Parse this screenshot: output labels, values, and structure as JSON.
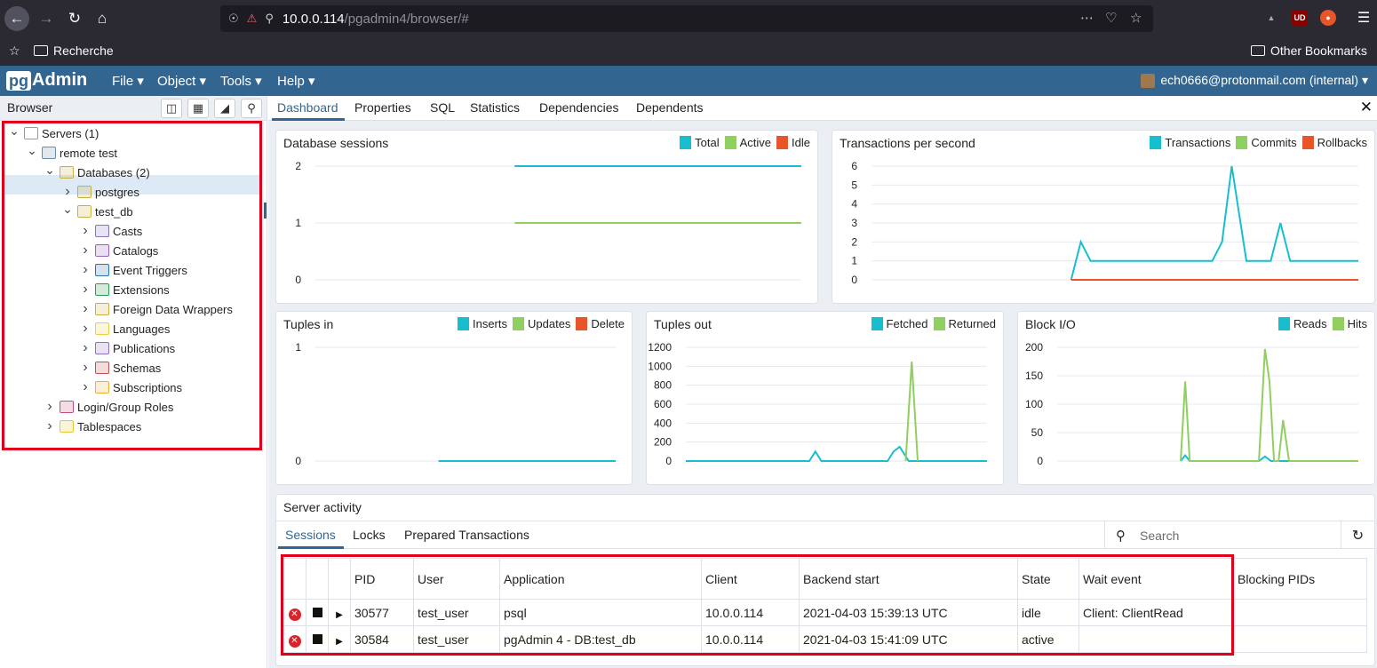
{
  "browser": {
    "url_host": "10.0.0.114",
    "url_path": "/pgadmin4/browser/#",
    "bookmark_left": "Recherche",
    "bookmark_right": "Other Bookmarks",
    "ext_ud": "UD"
  },
  "app": {
    "logo_pg": "pg",
    "logo_admin": "Admin",
    "menus": [
      "File ▾",
      "Object ▾",
      "Tools ▾",
      "Help ▾"
    ],
    "user": "ech0666@protonmail.com (internal) ▾"
  },
  "left_panel": {
    "title": "Browser",
    "tree": [
      {
        "label": "Servers (1)",
        "depth": 0,
        "expander": "v"
      },
      {
        "label": "remote test",
        "depth": 1,
        "expander": "v"
      },
      {
        "label": "Databases (2)",
        "depth": 2,
        "expander": "v"
      },
      {
        "label": "postgres",
        "depth": 3,
        "expander": ">"
      },
      {
        "label": "test_db",
        "depth": 3,
        "expander": "v",
        "selected": true
      },
      {
        "label": "Casts",
        "depth": 4,
        "expander": ">"
      },
      {
        "label": "Catalogs",
        "depth": 4,
        "expander": ">"
      },
      {
        "label": "Event Triggers",
        "depth": 4,
        "expander": ">"
      },
      {
        "label": "Extensions",
        "depth": 4,
        "expander": ">"
      },
      {
        "label": "Foreign Data Wrappers",
        "depth": 4,
        "expander": ">"
      },
      {
        "label": "Languages",
        "depth": 4,
        "expander": ">"
      },
      {
        "label": "Publications",
        "depth": 4,
        "expander": ">"
      },
      {
        "label": "Schemas",
        "depth": 4,
        "expander": ">"
      },
      {
        "label": "Subscriptions",
        "depth": 4,
        "expander": ">"
      },
      {
        "label": "Login/Group Roles",
        "depth": 2,
        "expander": ">"
      },
      {
        "label": "Tablespaces",
        "depth": 2,
        "expander": ">"
      }
    ]
  },
  "tabs": [
    "Dashboard",
    "Properties",
    "SQL",
    "Statistics",
    "Dependencies",
    "Dependents"
  ],
  "colors": {
    "cyan": "#17becf",
    "green": "#8fcf5f",
    "red": "#e8552a",
    "accent": "#326690"
  },
  "chart_data": [
    {
      "id": "db_sessions",
      "type": "line",
      "title": "Database sessions",
      "ylim": [
        0,
        2
      ],
      "yticks": [
        "2",
        "1",
        "0"
      ],
      "xrange": [
        0,
        100
      ],
      "series": [
        {
          "name": "Total",
          "color": "#17becf",
          "x": [
            41,
            100
          ],
          "values": [
            2,
            2
          ]
        },
        {
          "name": "Active",
          "color": "#8fcf5f",
          "x": [
            41,
            100
          ],
          "values": [
            1,
            1
          ]
        },
        {
          "name": "Idle",
          "color": "#e8552a",
          "x": [],
          "values": []
        }
      ]
    },
    {
      "id": "tps",
      "type": "line",
      "title": "Transactions per second",
      "ylim": [
        0,
        6
      ],
      "yticks": [
        "6",
        "5",
        "4",
        "3",
        "2",
        "1",
        "0"
      ],
      "xrange": [
        0,
        100
      ],
      "series": [
        {
          "name": "Transactions",
          "color": "#17becf",
          "x": [
            41,
            43,
            45,
            70,
            72,
            74,
            77,
            82,
            84,
            86,
            88,
            100
          ],
          "values": [
            0,
            2,
            1,
            1,
            2,
            6,
            1,
            1,
            3,
            1,
            1,
            1
          ]
        },
        {
          "name": "Commits",
          "color": "#8fcf5f",
          "x": [],
          "values": []
        },
        {
          "name": "Rollbacks",
          "color": "#e8552a",
          "x": [
            41,
            100
          ],
          "values": [
            0,
            0
          ]
        }
      ]
    },
    {
      "id": "tuples_in",
      "type": "line",
      "title": "Tuples in",
      "ylim": [
        0,
        1
      ],
      "yticks": [
        "1",
        "0"
      ],
      "xrange": [
        0,
        100
      ],
      "series": [
        {
          "name": "Inserts",
          "color": "#17becf",
          "x": [
            41,
            100
          ],
          "values": [
            0,
            0
          ]
        },
        {
          "name": "Updates",
          "color": "#8fcf5f",
          "x": [],
          "values": []
        },
        {
          "name": "Delete",
          "color": "#e8552a",
          "x": [],
          "values": []
        }
      ]
    },
    {
      "id": "tuples_out",
      "type": "line",
      "title": "Tuples out",
      "ylim": [
        0,
        1200
      ],
      "yticks": [
        "1200",
        "1000",
        "800",
        "600",
        "400",
        "200",
        "0"
      ],
      "xrange": [
        0,
        100
      ],
      "series": [
        {
          "name": "Fetched",
          "color": "#17becf",
          "x": [
            0,
            41,
            43,
            45,
            67,
            69,
            71,
            74,
            100
          ],
          "values": [
            0,
            0,
            100,
            0,
            0,
            100,
            150,
            0,
            0
          ]
        },
        {
          "name": "Returned",
          "color": "#8fcf5f",
          "x": [
            73,
            75,
            77
          ],
          "values": [
            0,
            1050,
            0
          ]
        }
      ]
    },
    {
      "id": "block_io",
      "type": "line",
      "title": "Block I/O",
      "ylim": [
        0,
        200
      ],
      "yticks": [
        "200",
        "150",
        "100",
        "50",
        "0"
      ],
      "xrange": [
        0,
        100
      ],
      "series": [
        {
          "name": "Reads",
          "color": "#17becf",
          "x": [
            41,
            42.5,
            44,
            67,
            69,
            71,
            100
          ],
          "values": [
            0,
            10,
            0,
            0,
            8,
            0,
            0
          ]
        },
        {
          "name": "Hits",
          "color": "#8fcf5f",
          "x": [
            41,
            42.5,
            44,
            67,
            69,
            70.5,
            72,
            73.5,
            75,
            77,
            100
          ],
          "values": [
            0,
            140,
            0,
            0,
            197,
            140,
            0,
            0,
            72,
            0,
            0
          ]
        }
      ]
    }
  ],
  "activity": {
    "title": "Server activity",
    "tabs": [
      "Sessions",
      "Locks",
      "Prepared Transactions"
    ],
    "search_placeholder": "Search",
    "columns": [
      "PID",
      "User",
      "Application",
      "Client",
      "Backend start",
      "State",
      "Wait event",
      "Blocking PIDs"
    ],
    "rows": [
      [
        "30577",
        "test_user",
        "psql",
        "10.0.0.114",
        "2021-04-03 15:39:13 UTC",
        "idle",
        "Client: ClientRead",
        ""
      ],
      [
        "30584",
        "test_user",
        "pgAdmin 4 - DB:test_db",
        "10.0.0.114",
        "2021-04-03 15:41:09 UTC",
        "active",
        "",
        ""
      ]
    ]
  }
}
